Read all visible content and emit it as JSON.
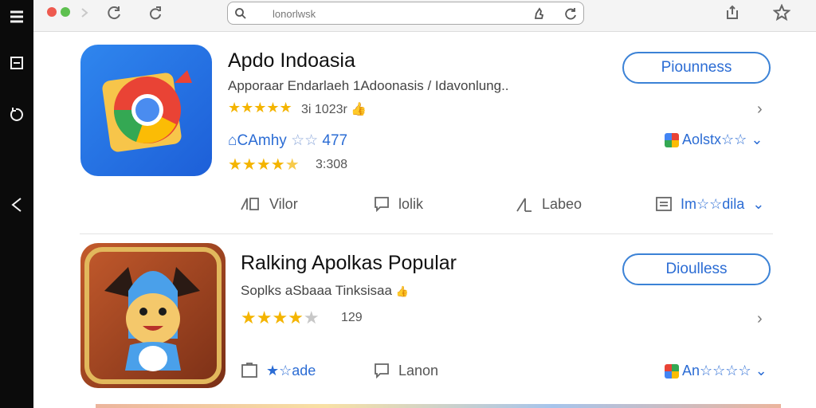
{
  "browser": {
    "address_query": "lonorlwsk"
  },
  "apps": [
    {
      "title": "Apdo Indoasia",
      "subtitle": "Apporaar Endarlaeh 1Adoonasis / Idavonlung..",
      "rating_text": "3i 1023r",
      "author": "CAmhy",
      "author_stars": "☆☆",
      "count": "477",
      "rating2_text": "3:308",
      "button_label": "Piounness",
      "badge_text": "Aolstx☆☆",
      "actions": [
        "Vilor",
        "lolik",
        "Labeo",
        "Im☆☆dila"
      ]
    },
    {
      "title": "Ralking Apolkas Popular",
      "subtitle": "Soplks aSbaaa Tinksisaa",
      "rating_text": "129",
      "button_label": "Dioulless",
      "badge_text": "An☆☆☆☆",
      "actions": [
        "★☆ade",
        "Lanon"
      ]
    }
  ],
  "colors": {
    "accent": "#2b6cd4",
    "star": "#f4b400",
    "rail": "#0b0b0b"
  }
}
